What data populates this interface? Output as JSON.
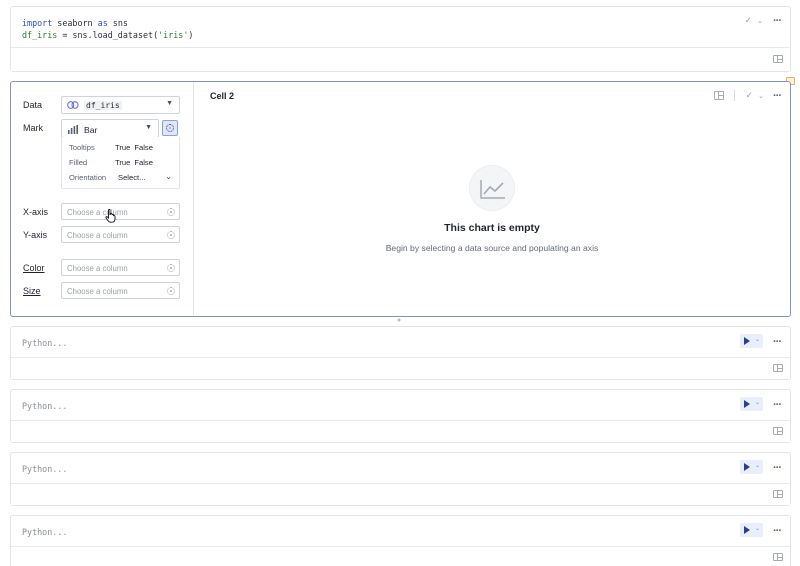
{
  "cell1": {
    "code_line1": {
      "kw1": "import",
      "mid": " seaborn ",
      "kw2": "as",
      "end": " sns"
    },
    "code_line2": {
      "var": "df_iris",
      "mid": " = sns.load_dataset(",
      "str": "'iris'",
      "end": ")"
    }
  },
  "chart_cell": {
    "title": "Cell 2",
    "data_label": "Data",
    "data_value": "df_iris",
    "mark_label": "Mark",
    "mark_value": "Bar",
    "options": {
      "tooltips_label": "Tooltips",
      "filled_label": "Filled",
      "orientation_label": "Orientation",
      "true_label": "True",
      "false_label": "False",
      "orientation_value": "Select..."
    },
    "xaxis_label": "X-axis",
    "yaxis_label": "Y-axis",
    "color_label": "Color",
    "size_label": "Size",
    "column_placeholder": "Choose a column",
    "empty_title": "This chart is empty",
    "empty_subtitle": "Begin by selecting a data source and populating an axis"
  },
  "python_cells": [
    {
      "placeholder": "Python..."
    },
    {
      "placeholder": "Python..."
    },
    {
      "placeholder": "Python..."
    },
    {
      "placeholder": "Python..."
    }
  ],
  "colors": {
    "accent": "#2a3f8f",
    "focus_border": "#7f93c9",
    "keyword": "#2b4fd6",
    "string": "#2a7a3b"
  },
  "icons": [
    "check-icon",
    "chevron-down-icon",
    "more-icon",
    "split-view-icon",
    "link-icon",
    "bar-chart-icon",
    "gear-icon",
    "line-chart-icon",
    "play-icon",
    "pointer-cursor-icon"
  ]
}
